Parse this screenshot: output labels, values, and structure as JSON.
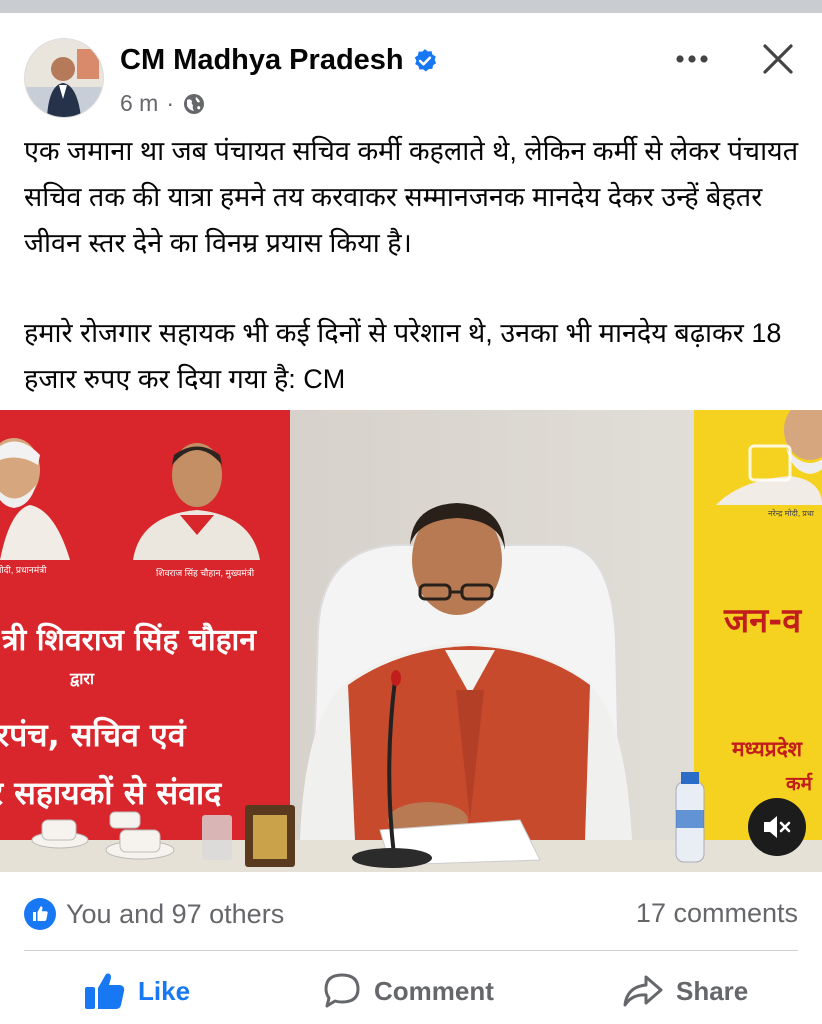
{
  "post": {
    "author": "CM Madhya Pradesh",
    "time": "6 m",
    "separator": "·",
    "paragraph1": "एक जमाना था जब पंचायत सचिव कर्मी कहलाते थे, लेकिन कर्मी से लेकर पंचायत सचिव तक की यात्रा हमने तय करवाकर सम्मानजनक मानदेय देकर उन्हें बेहतर जीवन स्तर देने का विनम्र प्रयास किया है।",
    "paragraph2": "हमारे रोजगार सहायक भी कई दिनों से परेशान थे, उनका भी मानदेय बढ़ाकर 18 हजार रुपए कर दिया गया है: CM"
  },
  "media": {
    "banner_left": {
      "line1": "त्री शिवराज सिंह चौहान",
      "line2": "द्वारा",
      "line3": "रपंच, सचिव एवं",
      "line4": "र सहायकों से संवाद",
      "caption_left": "मोदी, प्रधानमंत्री",
      "caption_right": "शिवराज सिंह चौहान, मुख्यमंत्री"
    },
    "banner_right": {
      "caption": "नरेन्द्र मोदी, प्रधा",
      "line1": "जन-व",
      "line2": "मध्यप्रदेश",
      "line3": "कर्म"
    }
  },
  "footer": {
    "reactions_text": "You and 97 others",
    "comments_text": "17 comments",
    "like_label": "Like",
    "comment_label": "Comment",
    "share_label": "Share"
  },
  "colors": {
    "accent": "#1877f2",
    "secondary_text": "#65676b",
    "banner_red": "#d8262c",
    "banner_yellow": "#f5d21f"
  }
}
